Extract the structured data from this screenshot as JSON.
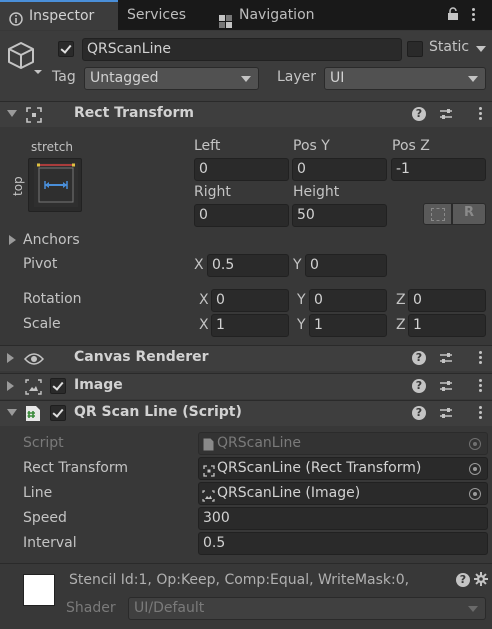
{
  "tabs": [
    {
      "label": "Inspector"
    },
    {
      "label": "Services"
    },
    {
      "label": "Navigation"
    }
  ],
  "gameobject": {
    "active": true,
    "name": "QRScanLine",
    "static_label": "Static",
    "tag_label": "Tag",
    "tag_value": "Untagged",
    "layer_label": "Layer",
    "layer_value": "UI"
  },
  "rect_transform": {
    "title": "Rect Transform",
    "anchor_preset": {
      "horizontal": "stretch",
      "vertical": "top"
    },
    "left": {
      "label": "Left",
      "value": "0"
    },
    "pos_y": {
      "label": "Pos Y",
      "value": "0"
    },
    "pos_z": {
      "label": "Pos Z",
      "value": "-1"
    },
    "right": {
      "label": "Right",
      "value": "0"
    },
    "height": {
      "label": "Height",
      "value": "50"
    },
    "r_button": "R",
    "anchors_label": "Anchors",
    "pivot": {
      "label": "Pivot",
      "x_label": "X",
      "x": "0.5",
      "y_label": "Y",
      "y": "0"
    },
    "rotation": {
      "label": "Rotation",
      "x_label": "X",
      "x": "0",
      "y_label": "Y",
      "y": "0",
      "z_label": "Z",
      "z": "0"
    },
    "scale": {
      "label": "Scale",
      "x_label": "X",
      "x": "1",
      "y_label": "Y",
      "y": "1",
      "z_label": "Z",
      "z": "1"
    }
  },
  "components": {
    "canvas_renderer": {
      "title": "Canvas Renderer"
    },
    "image": {
      "title": "Image",
      "enabled": true
    },
    "script": {
      "title": "QR Scan Line (Script)",
      "enabled": true
    }
  },
  "script_fields": {
    "script": {
      "label": "Script",
      "value": "QRScanLine"
    },
    "rect_transform": {
      "label": "Rect Transform",
      "value": "QRScanLine (Rect Transform)"
    },
    "line": {
      "label": "Line",
      "value": "QRScanLine (Image)"
    },
    "speed": {
      "label": "Speed",
      "value": "300"
    },
    "interval": {
      "label": "Interval",
      "value": "0.5"
    }
  },
  "material": {
    "stencil_text": "Stencil Id:1, Op:Keep, Comp:Equal, WriteMask:0,",
    "shader_label": "Shader",
    "shader_value": "UI/Default"
  },
  "colors": {
    "background": "#383838",
    "header": "#3e3e3e",
    "field": "#2a2a2a",
    "accent": "#4a8fd9",
    "script_icon": "#3a8a3a"
  }
}
